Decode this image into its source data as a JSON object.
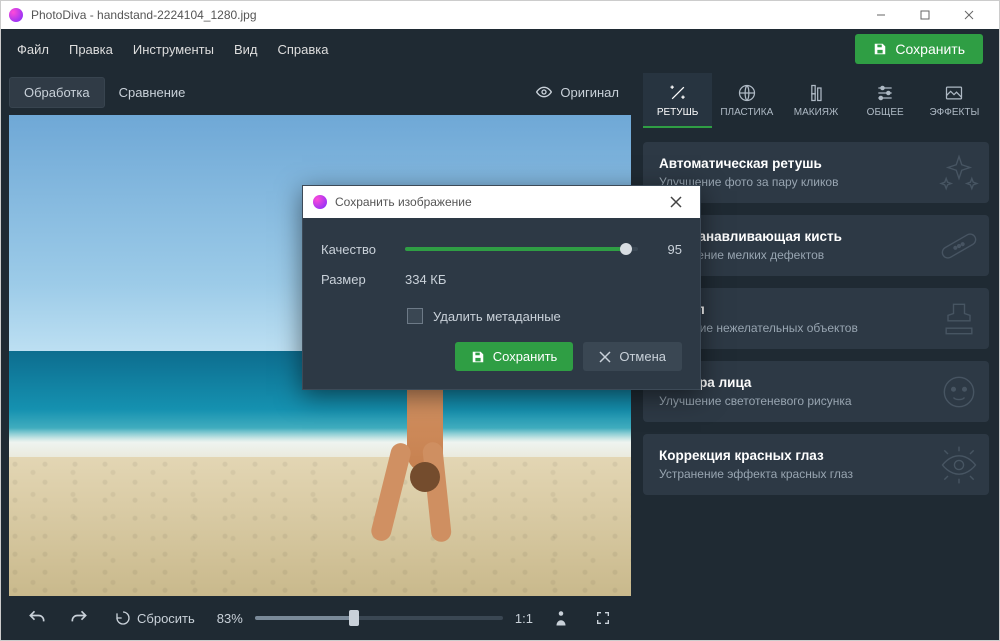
{
  "titlebar": {
    "app_name": "PhotoDiva",
    "filename": "handstand-2224104_1280.jpg"
  },
  "menu": {
    "file": "Файл",
    "edit": "Правка",
    "tools": "Инструменты",
    "view": "Вид",
    "help": "Справка"
  },
  "top_save_label": "Сохранить",
  "canvas_tabs": {
    "processing": "Обработка",
    "compare": "Сравнение"
  },
  "original_label": "Оригинал",
  "bottombar": {
    "reset": "Сбросить",
    "zoom_percent": "83%",
    "ratio": "1:1"
  },
  "tooltabs": {
    "retouch": "РЕТУШЬ",
    "plastic": "ПЛАСТИКА",
    "makeup": "МАКИЯЖ",
    "general": "ОБЩЕЕ",
    "effects": "ЭФФЕКТЫ"
  },
  "cards": [
    {
      "title": "Автоматическая ретушь",
      "desc": "Улучшение фото за пару кликов"
    },
    {
      "title": "Восстанавливающая кисть",
      "desc": "Устранение мелких дефектов"
    },
    {
      "title": "Штамп",
      "desc": "Удаление нежелательных объектов"
    },
    {
      "title": "Фактура лица",
      "desc": "Улучшение светотеневого рисунка"
    },
    {
      "title": "Коррекция красных глаз",
      "desc": "Устранение эффекта красных глаз"
    }
  ],
  "modal": {
    "title": "Сохранить изображение",
    "quality_label": "Качество",
    "quality_value": "95",
    "size_label": "Размер",
    "size_value": "334 КБ",
    "delete_meta": "Удалить метаданные",
    "save": "Сохранить",
    "cancel": "Отмена"
  }
}
